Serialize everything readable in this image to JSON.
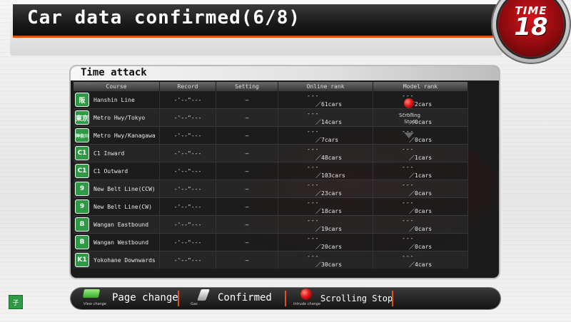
{
  "header": {
    "title": "Car data confirmed(6/8)"
  },
  "timer": {
    "label": "TIME",
    "value": "18"
  },
  "panel": {
    "title": "Time attack",
    "columns": [
      "Course",
      "Record",
      "Setting",
      "Online rank",
      "Model rank"
    ],
    "rows": [
      {
        "badge": "阪",
        "course": "Hanshin Line",
        "record": "-'--\"---",
        "setting": "—",
        "online_dash": "---",
        "online_cars": "／61cars",
        "model_dash": "---",
        "model_cars": "／2cars"
      },
      {
        "badge": "東京",
        "course": "Metro Hwy/Tokyo",
        "record": "-'--\"---",
        "setting": "—",
        "online_dash": "---",
        "online_cars": "／14cars",
        "model_dash": "---",
        "model_cars": "／0cars"
      },
      {
        "badge": "神奈川",
        "course": "Metro Hwy/Kanagawa",
        "record": "-'--\"---",
        "setting": "—",
        "online_dash": "---",
        "online_cars": "／7cars",
        "model_dash": "---",
        "model_cars": "／0cars"
      },
      {
        "badge": "C1",
        "course": "C1 Inward",
        "record": "-'--\"---",
        "setting": "—",
        "online_dash": "---",
        "online_cars": "／48cars",
        "model_dash": "---",
        "model_cars": "／1cars"
      },
      {
        "badge": "C1",
        "course": "C1 Outward",
        "record": "-'--\"---",
        "setting": "—",
        "online_dash": "---",
        "online_cars": "／103cars",
        "model_dash": "---",
        "model_cars": "／1cars"
      },
      {
        "badge": "9",
        "course": "New Belt Line(CCW)",
        "record": "-'--\"---",
        "setting": "—",
        "online_dash": "---",
        "online_cars": "／23cars",
        "model_dash": "---",
        "model_cars": "／0cars"
      },
      {
        "badge": "9",
        "course": "New Belt Line(CW)",
        "record": "-'--\"---",
        "setting": "—",
        "online_dash": "---",
        "online_cars": "／18cars",
        "model_dash": "---",
        "model_cars": "／0cars"
      },
      {
        "badge": "B",
        "course": "Wangan Eastbound",
        "record": "-'--\"---",
        "setting": "—",
        "online_dash": "---",
        "online_cars": "／19cars",
        "model_dash": "---",
        "model_cars": "／0cars"
      },
      {
        "badge": "B",
        "course": "Wangan Westbound",
        "record": "-'--\"---",
        "setting": "—",
        "online_dash": "---",
        "online_cars": "／20cars",
        "model_dash": "---",
        "model_cars": "／0cars"
      },
      {
        "badge": "K1",
        "course": "Yokohane Downwards",
        "record": "-'--\"---",
        "setting": "—",
        "online_dash": "---",
        "online_cars": "／30cars",
        "model_dash": "---",
        "model_cars": "／4cars"
      }
    ],
    "scroll_label_1": "Scrolling",
    "scroll_label_2": "Stop"
  },
  "bottom_bar": {
    "page_change_label": "Page change",
    "page_change_caption": "View change",
    "confirmed_label": "Confirmed",
    "confirmed_caption": "Gas",
    "scrolling_stop_label": "Scrolling Stop",
    "scrolling_stop_caption": "Intrude change"
  },
  "corner_icon": {
    "label": "子"
  },
  "colors": {
    "accent": "#e0501a",
    "route_green": "#2e9a45",
    "timer_red": "#d2151a"
  }
}
